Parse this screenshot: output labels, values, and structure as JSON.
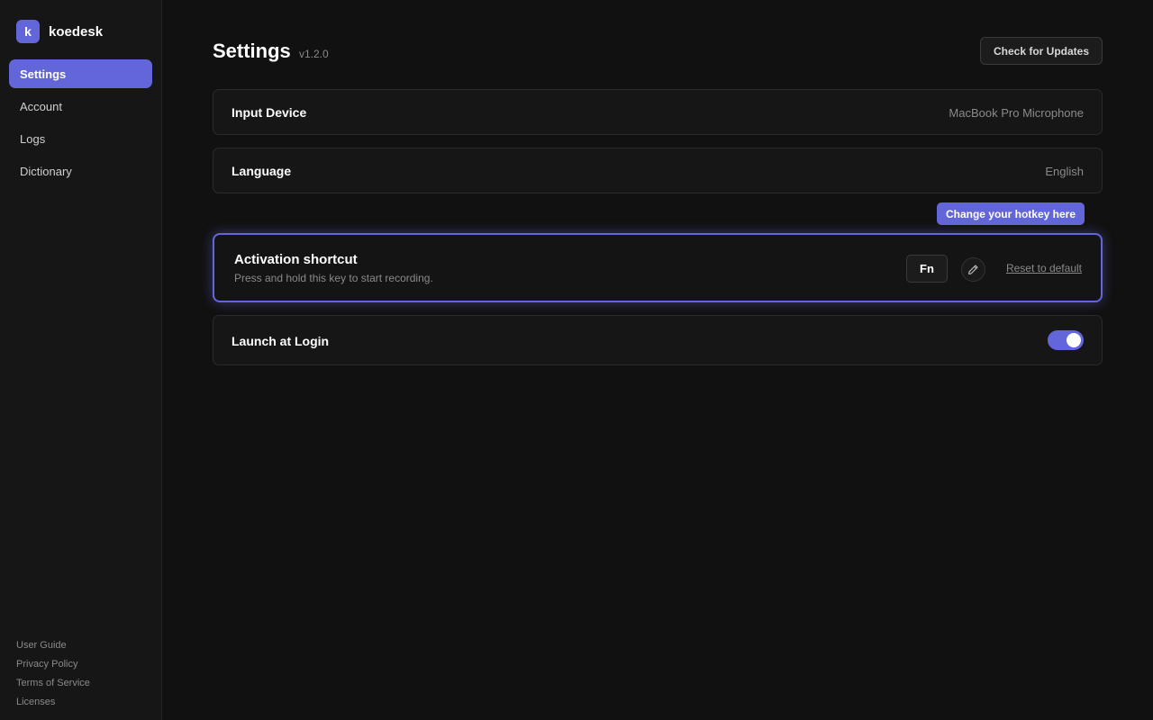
{
  "app": {
    "logo_letter": "k",
    "name": "koedesk"
  },
  "sidebar": {
    "items": [
      {
        "label": "Settings",
        "active": true
      },
      {
        "label": "Account",
        "active": false
      },
      {
        "label": "Logs",
        "active": false
      },
      {
        "label": "Dictionary",
        "active": false
      }
    ],
    "footer": [
      "User Guide",
      "Privacy Policy",
      "Terms of Service",
      "Licenses"
    ]
  },
  "header": {
    "title": "Settings",
    "version": "v1.2.0",
    "update_button": "Check for Updates"
  },
  "settings": {
    "input_device": {
      "label": "Input Device",
      "value": "MacBook Pro Microphone"
    },
    "language": {
      "label": "Language",
      "value": "English"
    },
    "shortcut": {
      "tooltip": "Change your hotkey here",
      "title": "Activation shortcut",
      "description": "Press and hold this key to start recording.",
      "key": "Fn",
      "edit_icon": "pencil-icon",
      "reset_label": "Reset to default"
    },
    "launch_at_login": {
      "label": "Launch at Login",
      "enabled": true
    }
  },
  "colors": {
    "accent": "#6366d8",
    "background": "#111111",
    "sidebar": "#161616",
    "card": "#161616"
  }
}
